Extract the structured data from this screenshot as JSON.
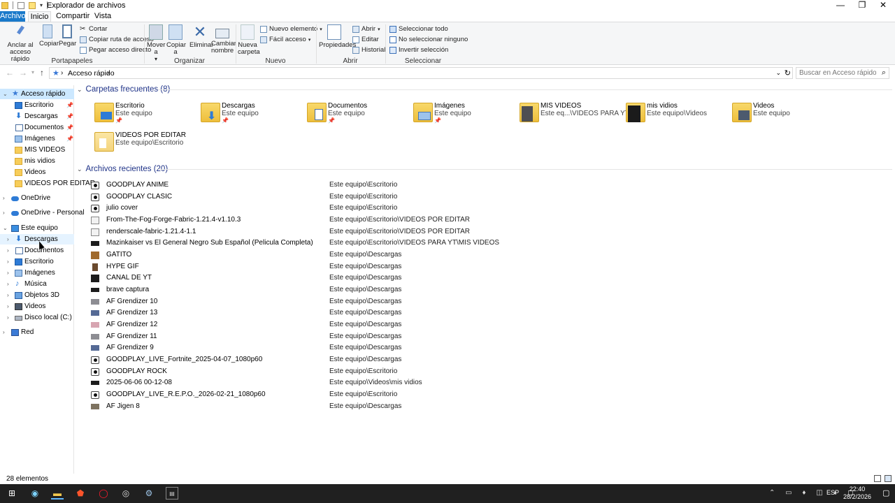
{
  "window": {
    "title": "Explorador de archivos",
    "controls": {
      "minimize": "—",
      "maximize": "❐",
      "close": "✕"
    }
  },
  "ribbon_tabs": [
    "Archivo",
    "Inicio",
    "Compartir",
    "Vista"
  ],
  "ribbon": {
    "portapapeles": {
      "label": "Portapapeles",
      "anclar": "Anclar al acceso rápido",
      "copiar": "Copiar",
      "pegar": "Pegar",
      "cortar": "Cortar",
      "copiar_ruta": "Copiar ruta de acceso",
      "pegar_acceso": "Pegar acceso directo"
    },
    "organizar": {
      "label": "Organizar",
      "mover": "Mover a",
      "copiar_a": "Copiar a",
      "eliminar": "Eliminar",
      "cambiar_nombre": "Cambiar nombre"
    },
    "nuevo": {
      "label": "Nuevo",
      "nueva_carpeta": "Nueva carpeta",
      "nuevo_elemento": "Nuevo elemento",
      "facil_acceso": "Fácil acceso"
    },
    "abrir": {
      "label": "Abrir",
      "propiedades": "Propiedades",
      "abrir": "Abrir",
      "editar": "Editar",
      "historial": "Historial"
    },
    "seleccionar": {
      "label": "Seleccionar",
      "todo": "Seleccionar todo",
      "ninguno": "No seleccionar ninguno",
      "invertir": "Invertir selección"
    }
  },
  "address": {
    "path": "Acceso rápido",
    "search_placeholder": "Buscar en Acceso rápido"
  },
  "nav": {
    "quick_access": "Acceso rápido",
    "quick_items": [
      "Escritorio",
      "Descargas",
      "Documentos",
      "Imágenes",
      "MIS VIDEOS",
      "mis vidios",
      "Videos",
      "VIDEOS POR EDITAR"
    ],
    "onedrive": "OneDrive",
    "onedrive_personal": "OneDrive - Personal",
    "this_pc": "Este equipo",
    "pc_items": [
      "Descargas",
      "Documentos",
      "Escritorio",
      "Imágenes",
      "Música",
      "Objetos 3D",
      "Videos",
      "Disco local (C:)"
    ],
    "network": "Red"
  },
  "frequent": {
    "header": "Carpetas frecuentes (8)",
    "items": [
      {
        "name": "Escritorio",
        "loc": "Este equipo"
      },
      {
        "name": "Descargas",
        "loc": "Este equipo"
      },
      {
        "name": "Documentos",
        "loc": "Este equipo"
      },
      {
        "name": "Imágenes",
        "loc": "Este equipo"
      },
      {
        "name": "MIS VIDEOS",
        "loc": "Este eq...\\VIDEOS PARA YT"
      },
      {
        "name": "mis vidios",
        "loc": "Este equipo\\Videos"
      },
      {
        "name": "Videos",
        "loc": "Este equipo"
      },
      {
        "name": "VIDEOS POR EDITAR",
        "loc": "Este equipo\\Escritorio"
      }
    ]
  },
  "recent": {
    "header": "Archivos recientes (20)",
    "items": [
      {
        "name": "GOODPLAY ANIME",
        "loc": "Este equipo\\Escritorio"
      },
      {
        "name": "GOODPLAY CLASIC",
        "loc": "Este equipo\\Escritorio"
      },
      {
        "name": "julio cover",
        "loc": "Este equipo\\Escritorio"
      },
      {
        "name": "From-The-Fog-Forge-Fabric-1.21.4-v1.10.3",
        "loc": "Este equipo\\Escritorio\\VIDEOS POR EDITAR"
      },
      {
        "name": "renderscale-fabric-1.21.4-1.1",
        "loc": "Este equipo\\Escritorio\\VIDEOS POR EDITAR"
      },
      {
        "name": "Mazinkaiser vs El General Negro Sub Español (Pelicula Completa)",
        "loc": "Este equipo\\Escritorio\\VIDEOS PARA YT\\MIS VIDEOS"
      },
      {
        "name": "GATITO",
        "loc": "Este equipo\\Descargas"
      },
      {
        "name": "HYPE GIF",
        "loc": "Este equipo\\Descargas"
      },
      {
        "name": "CANAL DE YT",
        "loc": "Este equipo\\Descargas"
      },
      {
        "name": "brave captura",
        "loc": "Este equipo\\Descargas"
      },
      {
        "name": "AF Grendizer 10",
        "loc": "Este equipo\\Descargas"
      },
      {
        "name": "AF Grendizer 13",
        "loc": "Este equipo\\Descargas"
      },
      {
        "name": "AF Grendizer 12",
        "loc": "Este equipo\\Descargas"
      },
      {
        "name": "AF Grendizer 11",
        "loc": "Este equipo\\Descargas"
      },
      {
        "name": "AF Grendizer 9",
        "loc": "Este equipo\\Descargas"
      },
      {
        "name": "GOODPLAY_LIVE_Fortnite_2025-04-07_1080p60",
        "loc": "Este equipo\\Descargas"
      },
      {
        "name": "GOODPLAY ROCK",
        "loc": "Este equipo\\Escritorio"
      },
      {
        "name": "2025-06-06 00-12-08",
        "loc": "Este equipo\\Videos\\mis vidios"
      },
      {
        "name": "GOODPLAY_LIVE_R.E.P.O._2026-02-21_1080p60",
        "loc": "Este equipo\\Escritorio"
      },
      {
        "name": "AF Jigen 8",
        "loc": "Este equipo\\Descargas"
      }
    ]
  },
  "status": {
    "count": "28 elementos"
  },
  "taskbar": {
    "lang": "ESP",
    "time": "22:40",
    "date": "28/2/2026"
  },
  "colors": {
    "accent": "#1979ca",
    "selection": "#cce8ff",
    "header_text": "#1e3287",
    "taskbar": "#202020"
  }
}
